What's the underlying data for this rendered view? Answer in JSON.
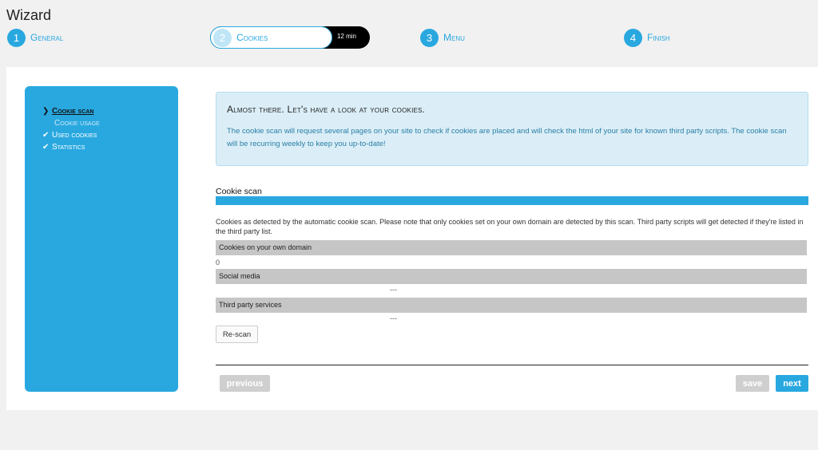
{
  "page": {
    "title": "Wizard"
  },
  "steps": [
    {
      "number": "1",
      "label": "General"
    },
    {
      "number": "2",
      "label": "Cookies",
      "time": "12 min"
    },
    {
      "number": "3",
      "label": "Menu"
    },
    {
      "number": "4",
      "label": "Finish"
    }
  ],
  "sidebar": {
    "items": [
      {
        "label": "Cookie scan",
        "mark": "❯"
      },
      {
        "label": "Cookie usage",
        "mark": ""
      },
      {
        "label": "Used cookies",
        "mark": "✔"
      },
      {
        "label": "Statistics",
        "mark": "✔"
      }
    ]
  },
  "notice": {
    "heading": "Almost there. Let's have a look at your cookies.",
    "text": "The cookie scan will request several pages on your site to check if cookies are placed and will check the html of your site for known third party scripts. The cookie scan will be recurring weekly to keep you up-to-date!"
  },
  "scan": {
    "title": "Cookie scan",
    "progress": 1.0,
    "description": "Cookies as detected by the automatic cookie scan. Please note that only cookies set on your own domain are detected by this scan. Third party scripts will get detected if they're listed in the third party list.",
    "own_domain_label": "Cookies on your own domain",
    "own_domain_value": "0",
    "social_label": "Social media",
    "social_value": "---",
    "third_party_label": "Third party services",
    "third_party_value": "---",
    "rescan_label": "Re-scan"
  },
  "footer": {
    "previous_label": "previous",
    "save_label": "save",
    "next_label": "next"
  },
  "colors": {
    "accent": "#29a8e0",
    "disabled": "#cfcfcf"
  }
}
